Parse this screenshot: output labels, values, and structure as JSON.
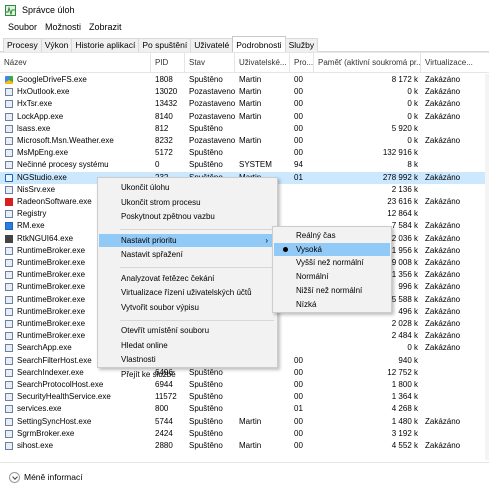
{
  "window": {
    "title": "Správce úloh"
  },
  "menubar": [
    "Soubor",
    "Možnosti",
    "Zobrazit"
  ],
  "tabs": [
    {
      "label": "Procesy",
      "active": false
    },
    {
      "label": "Výkon",
      "active": false
    },
    {
      "label": "Historie aplikací",
      "active": false
    },
    {
      "label": "Po spuštění",
      "active": false
    },
    {
      "label": "Uživatelé",
      "active": false
    },
    {
      "label": "Podrobnosti",
      "active": true
    },
    {
      "label": "Služby",
      "active": false
    }
  ],
  "columns": {
    "name": "Název",
    "pid": "PID",
    "status": "Stav",
    "user": "Uživatelské...",
    "cpu": "Pro...",
    "memory": "Paměť (aktivní soukromá pr...",
    "virt": "Virtualizace..."
  },
  "rows": [
    {
      "name": "GoogleDriveFS.exe",
      "pid": "1808",
      "status": "Spuštěno",
      "user": "Martin",
      "cpu": "00",
      "mem": "8 172 k",
      "virt": "Zakázáno",
      "icon": "drive-icon"
    },
    {
      "name": "HxOutlook.exe",
      "pid": "13020",
      "status": "Pozastaveno",
      "user": "Martin",
      "cpu": "00",
      "mem": "0 k",
      "virt": "Zakázáno",
      "icon": "app-icon"
    },
    {
      "name": "HxTsr.exe",
      "pid": "13432",
      "status": "Pozastaveno",
      "user": "Martin",
      "cpu": "00",
      "mem": "0 k",
      "virt": "Zakázáno",
      "icon": "app-icon"
    },
    {
      "name": "LockApp.exe",
      "pid": "8140",
      "status": "Pozastaveno",
      "user": "Martin",
      "cpu": "00",
      "mem": "0 k",
      "virt": "Zakázáno",
      "icon": "app-icon"
    },
    {
      "name": "lsass.exe",
      "pid": "812",
      "status": "Spuštěno",
      "user": "",
      "cpu": "00",
      "mem": "5 920 k",
      "virt": "",
      "icon": "app-icon"
    },
    {
      "name": "Microsoft.Msn.Weather.exe",
      "pid": "8232",
      "status": "Pozastaveno",
      "user": "Martin",
      "cpu": "00",
      "mem": "0 k",
      "virt": "Zakázáno",
      "icon": "app-icon"
    },
    {
      "name": "MsMpEng.exe",
      "pid": "5172",
      "status": "Spuštěno",
      "user": "",
      "cpu": "00",
      "mem": "132 916 k",
      "virt": "",
      "icon": "app-icon"
    },
    {
      "name": "Nečinné procesy systému",
      "pid": "0",
      "status": "Spuštěno",
      "user": "SYSTEM",
      "cpu": "94",
      "mem": "8 k",
      "virt": "",
      "icon": "app-icon"
    },
    {
      "name": "NGStudio.exe",
      "pid": "232",
      "status": "Spuštěno",
      "user": "Martin",
      "cpu": "01",
      "mem": "278 992 k",
      "virt": "Zakázáno",
      "icon": "eye-icon",
      "selected": true
    },
    {
      "name": "NisSrv.exe",
      "pid": "",
      "status": "",
      "user": "",
      "cpu": "",
      "mem": "2 136 k",
      "virt": "",
      "icon": "app-icon"
    },
    {
      "name": "RadeonSoftware.exe",
      "pid": "",
      "status": "",
      "user": "",
      "cpu": "",
      "mem": "23 616 k",
      "virt": "Zakázáno",
      "icon": "radeon-icon"
    },
    {
      "name": "Registry",
      "pid": "",
      "status": "",
      "user": "",
      "cpu": "",
      "mem": "12 864 k",
      "virt": "",
      "icon": "app-icon"
    },
    {
      "name": "RM.exe",
      "pid": "",
      "status": "",
      "user": "",
      "cpu": "",
      "mem": "7 584 k",
      "virt": "Zakázáno",
      "icon": "rm-icon"
    },
    {
      "name": "RtkNGUI64.exe",
      "pid": "",
      "status": "",
      "user": "",
      "cpu": "",
      "mem": "2 036 k",
      "virt": "Zakázáno",
      "icon": "rtk-icon"
    },
    {
      "name": "RuntimeBroker.exe",
      "pid": "",
      "status": "",
      "user": "",
      "cpu": "",
      "mem": "1 956 k",
      "virt": "Zakázáno",
      "icon": "app-icon"
    },
    {
      "name": "RuntimeBroker.exe",
      "pid": "",
      "status": "",
      "user": "",
      "cpu": "",
      "mem": "9 008 k",
      "virt": "Zakázáno",
      "icon": "app-icon"
    },
    {
      "name": "RuntimeBroker.exe",
      "pid": "",
      "status": "",
      "user": "",
      "cpu": "",
      "mem": "1 356 k",
      "virt": "Zakázáno",
      "icon": "app-icon"
    },
    {
      "name": "RuntimeBroker.exe",
      "pid": "",
      "status": "",
      "user": "",
      "cpu": "",
      "mem": "996 k",
      "virt": "Zakázáno",
      "icon": "app-icon"
    },
    {
      "name": "RuntimeBroker.exe",
      "pid": "",
      "status": "",
      "user": "",
      "cpu": "",
      "mem": "5 588 k",
      "virt": "Zakázáno",
      "icon": "app-icon"
    },
    {
      "name": "RuntimeBroker.exe",
      "pid": "",
      "status": "",
      "user": "",
      "cpu": "",
      "mem": "496 k",
      "virt": "Zakázáno",
      "icon": "app-icon"
    },
    {
      "name": "RuntimeBroker.exe",
      "pid": "",
      "status": "",
      "user": "",
      "cpu": "",
      "mem": "2 028 k",
      "virt": "Zakázáno",
      "icon": "app-icon"
    },
    {
      "name": "RuntimeBroker.exe",
      "pid": "",
      "status": "",
      "user": "",
      "cpu": "",
      "mem": "2 484 k",
      "virt": "Zakázáno",
      "icon": "app-icon"
    },
    {
      "name": "SearchApp.exe",
      "pid": "",
      "status": "",
      "user": "",
      "cpu": "",
      "mem": "0 k",
      "virt": "Zakázáno",
      "icon": "app-icon"
    },
    {
      "name": "SearchFilterHost.exe",
      "pid": "912",
      "status": "Spuštěno",
      "user": "",
      "cpu": "00",
      "mem": "940 k",
      "virt": "",
      "icon": "app-icon"
    },
    {
      "name": "SearchIndexer.exe",
      "pid": "6496",
      "status": "Spuštěno",
      "user": "",
      "cpu": "00",
      "mem": "12 752 k",
      "virt": "",
      "icon": "app-icon"
    },
    {
      "name": "SearchProtocolHost.exe",
      "pid": "6944",
      "status": "Spuštěno",
      "user": "",
      "cpu": "00",
      "mem": "1 800 k",
      "virt": "",
      "icon": "app-icon"
    },
    {
      "name": "SecurityHealthService.exe",
      "pid": "11572",
      "status": "Spuštěno",
      "user": "",
      "cpu": "00",
      "mem": "1 364 k",
      "virt": "",
      "icon": "app-icon"
    },
    {
      "name": "services.exe",
      "pid": "800",
      "status": "Spuštěno",
      "user": "",
      "cpu": "01",
      "mem": "4 268 k",
      "virt": "",
      "icon": "app-icon"
    },
    {
      "name": "SettingSyncHost.exe",
      "pid": "5744",
      "status": "Spuštěno",
      "user": "Martin",
      "cpu": "00",
      "mem": "1 480 k",
      "virt": "Zakázáno",
      "icon": "app-icon"
    },
    {
      "name": "SgrmBroker.exe",
      "pid": "2424",
      "status": "Spuštěno",
      "user": "",
      "cpu": "00",
      "mem": "3 192 k",
      "virt": "",
      "icon": "app-icon"
    },
    {
      "name": "sihost.exe",
      "pid": "2880",
      "status": "Spuštěno",
      "user": "Martin",
      "cpu": "00",
      "mem": "4 552 k",
      "virt": "Zakázáno",
      "icon": "app-icon"
    }
  ],
  "context_menu": {
    "items": [
      {
        "label": "Ukončit úlohu"
      },
      {
        "label": "Ukončit strom procesu"
      },
      {
        "label": "Poskytnout zpětnou vazbu"
      },
      {
        "sep": true
      },
      {
        "label": "Nastavit prioritu",
        "submenu": true,
        "hover": true
      },
      {
        "label": "Nastavit spřažení"
      },
      {
        "sep": true
      },
      {
        "label": "Analyzovat řetězec čekání"
      },
      {
        "label": "Virtualizace řízení uživatelských účtů"
      },
      {
        "label": "Vytvořit soubor výpisu"
      },
      {
        "sep": true
      },
      {
        "label": "Otevřít umístění souboru"
      },
      {
        "label": "Hledat online"
      },
      {
        "label": "Vlastnosti"
      },
      {
        "label": "Přejít ke službě"
      }
    ]
  },
  "priority_menu": {
    "items": [
      {
        "label": "Reálný čas"
      },
      {
        "label": "Vysoká",
        "checked": true,
        "hover": true
      },
      {
        "label": "Vyšší než normální"
      },
      {
        "label": "Normální"
      },
      {
        "label": "Nižší než normální"
      },
      {
        "label": "Nízká"
      }
    ]
  },
  "footer": {
    "label": "Méně informací"
  },
  "colors": {
    "selection": "#cce8ff",
    "menu_hover": "#91c9f7",
    "menu_bg": "#f2f2f2"
  }
}
